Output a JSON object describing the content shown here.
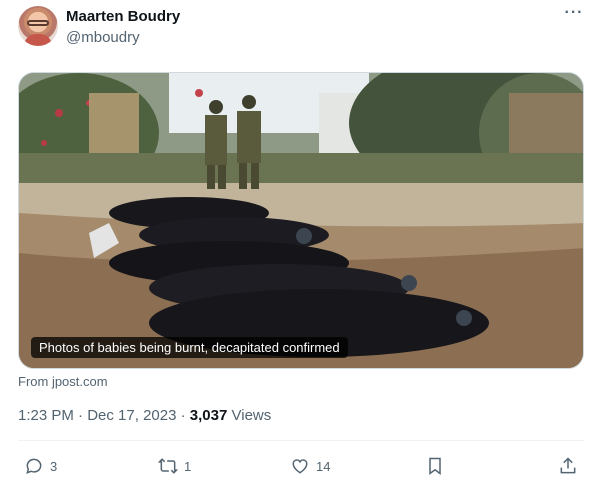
{
  "author": {
    "display_name": "Maarten Boudry",
    "handle": "@mboudry"
  },
  "menu": {
    "more_label": "···"
  },
  "media": {
    "caption": "Photos of babies being burnt, decapitated confirmed"
  },
  "source_text": "From jpost.com",
  "meta": {
    "time": "1:23 PM",
    "separator": "·",
    "date": "Dec 17, 2023",
    "views_count": "3,037",
    "views_label": "Views"
  },
  "actions": {
    "replies": "3",
    "reposts": "1",
    "likes": "14"
  },
  "icons": [
    "reply-icon",
    "repost-icon",
    "like-icon",
    "bookmark-icon",
    "share-icon",
    "more-icon"
  ]
}
